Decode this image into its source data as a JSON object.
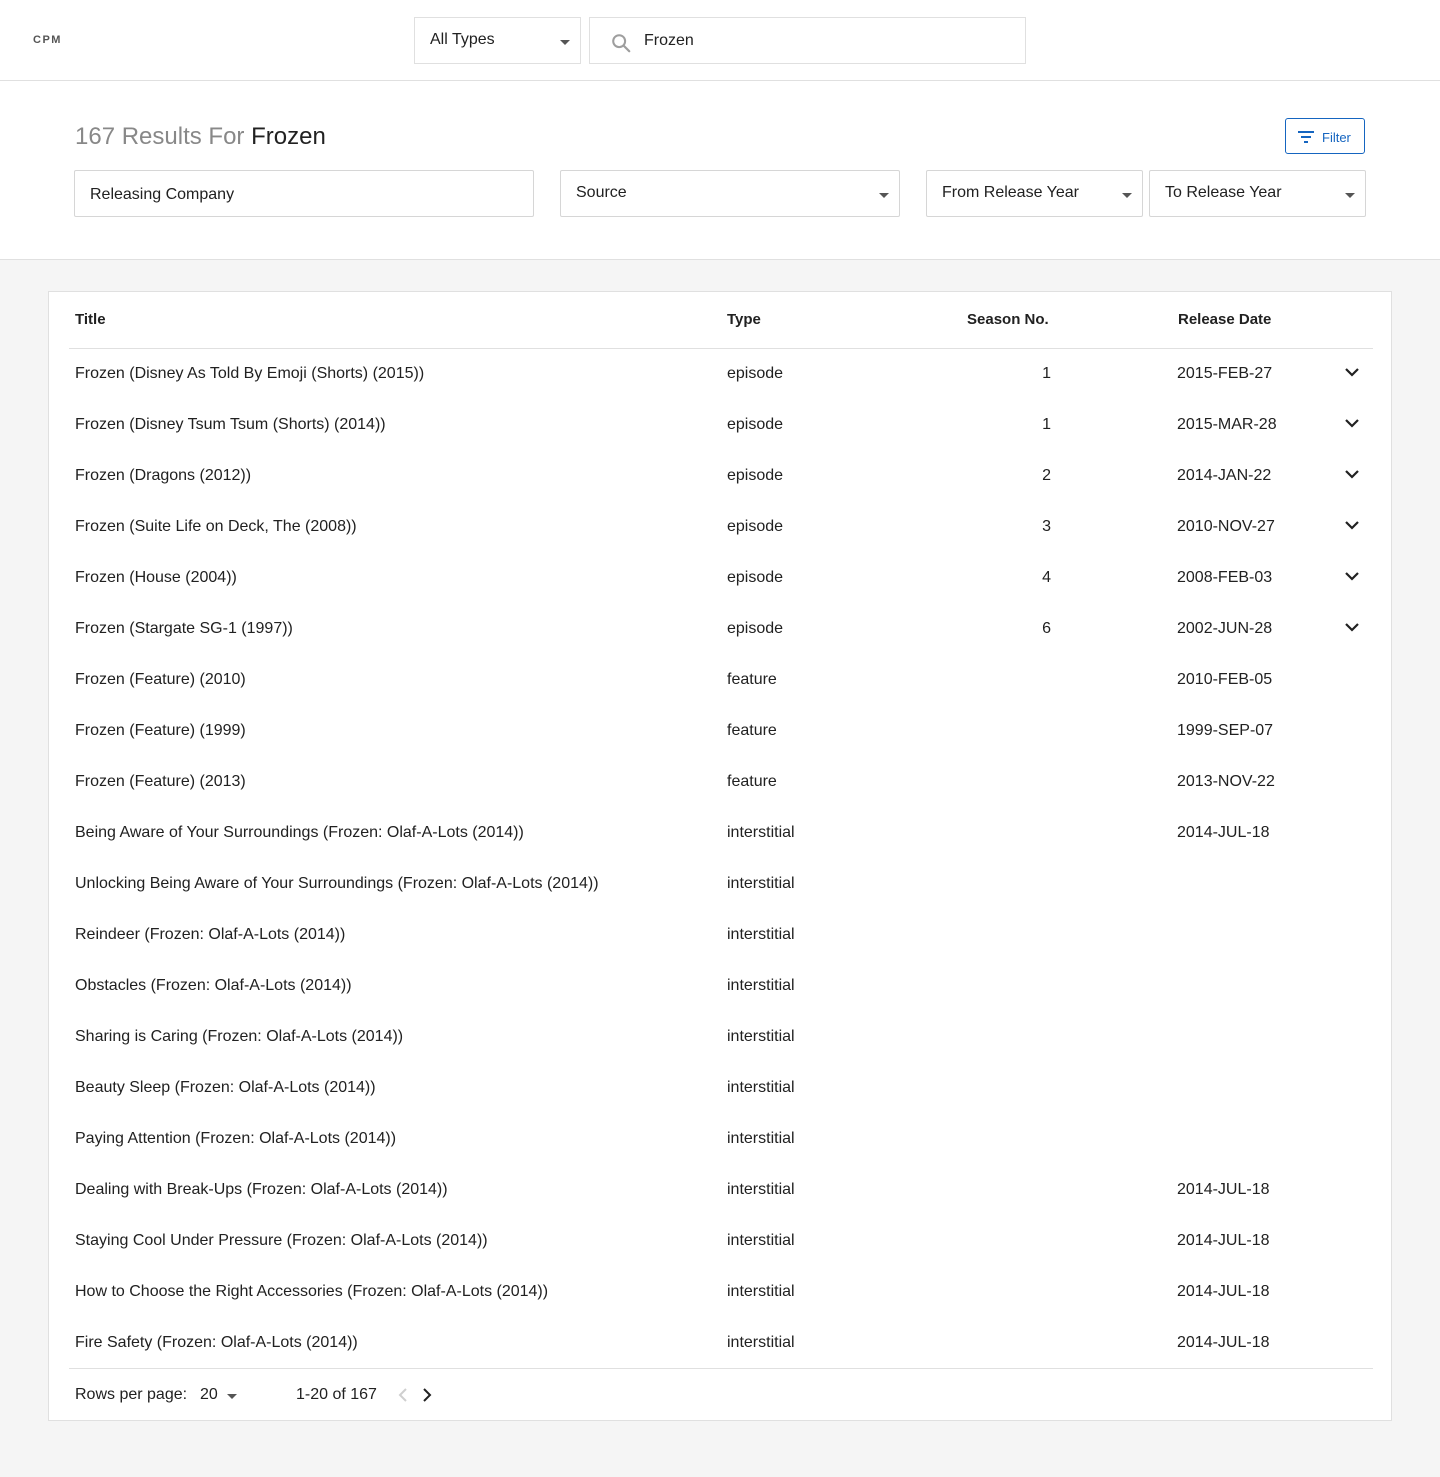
{
  "app": {
    "logo": "CPM"
  },
  "search": {
    "type_filter": "All Types",
    "query": "Frozen",
    "placeholder": ""
  },
  "results": {
    "count": "167",
    "label": "Results For",
    "query": "Frozen",
    "filter_button": "Filter"
  },
  "filters": {
    "releasing_company": "Releasing Company",
    "source": "Source",
    "from_release_year": "From Release Year",
    "to_release_year": "To Release Year"
  },
  "table": {
    "columns": [
      "Title",
      "Type",
      "Season No.",
      "Release Date"
    ],
    "rows": [
      {
        "title": "Frozen (Disney As Told By Emoji (Shorts) (2015))",
        "type": "episode",
        "season": "1",
        "date": "2015-FEB-27",
        "expandable": true
      },
      {
        "title": "Frozen (Disney Tsum Tsum (Shorts) (2014))",
        "type": "episode",
        "season": "1",
        "date": "2015-MAR-28",
        "expandable": true
      },
      {
        "title": "Frozen (Dragons (2012))",
        "type": "episode",
        "season": "2",
        "date": "2014-JAN-22",
        "expandable": true
      },
      {
        "title": "Frozen (Suite Life on Deck, The (2008))",
        "type": "episode",
        "season": "3",
        "date": "2010-NOV-27",
        "expandable": true
      },
      {
        "title": "Frozen (House (2004))",
        "type": "episode",
        "season": "4",
        "date": "2008-FEB-03",
        "expandable": true
      },
      {
        "title": "Frozen (Stargate SG-1 (1997))",
        "type": "episode",
        "season": "6",
        "date": "2002-JUN-28",
        "expandable": true
      },
      {
        "title": "Frozen (Feature) (2010)",
        "type": "feature",
        "season": "",
        "date": "2010-FEB-05",
        "expandable": false
      },
      {
        "title": "Frozen (Feature) (1999)",
        "type": "feature",
        "season": "",
        "date": "1999-SEP-07",
        "expandable": false
      },
      {
        "title": "Frozen (Feature) (2013)",
        "type": "feature",
        "season": "",
        "date": "2013-NOV-22",
        "expandable": false
      },
      {
        "title": "Being Aware of Your Surroundings (Frozen: Olaf-A-Lots (2014))",
        "type": "interstitial",
        "season": "",
        "date": "2014-JUL-18",
        "expandable": false
      },
      {
        "title": "Unlocking Being Aware of Your Surroundings (Frozen: Olaf-A-Lots (2014))",
        "type": "interstitial",
        "season": "",
        "date": "",
        "expandable": false
      },
      {
        "title": "Reindeer (Frozen: Olaf-A-Lots (2014))",
        "type": "interstitial",
        "season": "",
        "date": "",
        "expandable": false
      },
      {
        "title": "Obstacles (Frozen: Olaf-A-Lots (2014))",
        "type": "interstitial",
        "season": "",
        "date": "",
        "expandable": false
      },
      {
        "title": "Sharing is Caring (Frozen: Olaf-A-Lots (2014))",
        "type": "interstitial",
        "season": "",
        "date": "",
        "expandable": false
      },
      {
        "title": "Beauty Sleep (Frozen: Olaf-A-Lots (2014))",
        "type": "interstitial",
        "season": "",
        "date": "",
        "expandable": false
      },
      {
        "title": "Paying Attention (Frozen: Olaf-A-Lots (2014))",
        "type": "interstitial",
        "season": "",
        "date": "",
        "expandable": false
      },
      {
        "title": "Dealing with Break-Ups (Frozen: Olaf-A-Lots (2014))",
        "type": " interstitial",
        "season": "",
        "date": "2014-JUL-18",
        "expandable": false
      },
      {
        "title": "Staying Cool Under Pressure (Frozen: Olaf-A-Lots (2014))",
        "type": "interstitial",
        "season": "",
        "date": "2014-JUL-18",
        "expandable": false
      },
      {
        "title": "How to Choose the Right Accessories (Frozen: Olaf-A-Lots (2014))",
        "type": "interstitial",
        "season": "",
        "date": "2014-JUL-18",
        "expandable": false
      },
      {
        "title": "Fire Safety (Frozen: Olaf-A-Lots (2014))",
        "type": "interstitial",
        "season": "",
        "date": "2014-JUL-18",
        "expandable": false
      }
    ]
  },
  "pagination": {
    "rows_per_page_label": "Rows per page:",
    "rows_per_page": "20",
    "range": "1-20 of 167"
  },
  "colors": {
    "accent": "#1565c0",
    "text": "#212121",
    "muted": "#888888",
    "border": "#e0e0e0"
  }
}
